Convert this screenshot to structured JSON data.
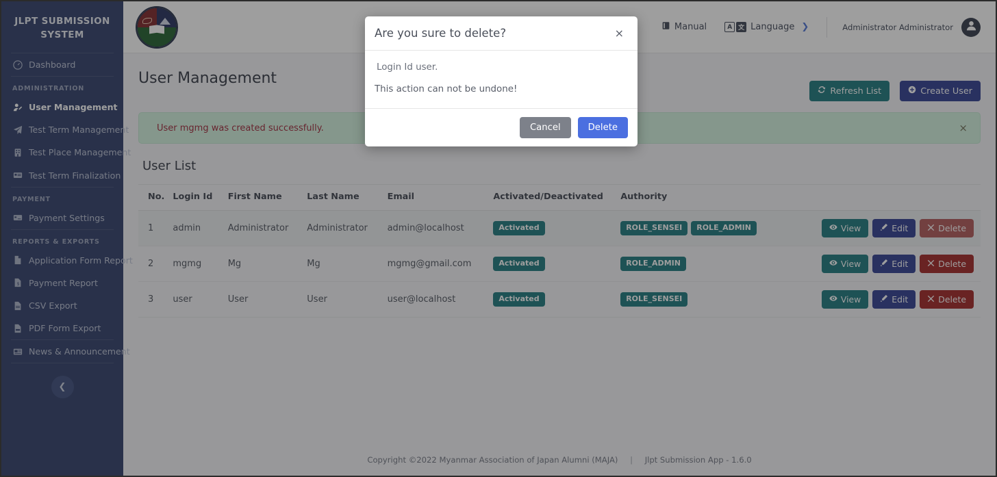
{
  "sidebar": {
    "brand": "JLPT SUBMISSION SYSTEM",
    "items": [
      {
        "label": "Dashboard",
        "icon": "dashboard-icon"
      }
    ],
    "sections": [
      {
        "heading": "ADMINISTRATION",
        "items": [
          {
            "label": "User Management",
            "icon": "user-edit-icon",
            "active": true
          },
          {
            "label": "Test Term Management",
            "icon": "paper-plane-icon",
            "active": false
          },
          {
            "label": "Test Place Management",
            "icon": "building-icon",
            "active": false
          },
          {
            "label": "Test Term Finalization",
            "icon": "id-card-icon",
            "active": false
          }
        ]
      },
      {
        "heading": "PAYMENT",
        "items": [
          {
            "label": "Payment Settings",
            "icon": "credit-card-icon",
            "active": false
          }
        ]
      },
      {
        "heading": "REPORTS & EXPORTS",
        "items": [
          {
            "label": "Application Form Report",
            "icon": "file-icon",
            "active": false
          },
          {
            "label": "Payment Report",
            "icon": "file-invoice-icon",
            "active": false
          },
          {
            "label": "CSV Export",
            "icon": "file-csv-icon",
            "active": false
          },
          {
            "label": "PDF Form Export",
            "icon": "file-pdf-icon",
            "active": false
          }
        ]
      },
      {
        "heading": "",
        "items": [
          {
            "label": "News & Announcement",
            "icon": "newspaper-icon",
            "active": false
          }
        ]
      }
    ],
    "collapse_icon": "chevron-left-icon"
  },
  "topbar": {
    "logo_alt": "maja-logo",
    "manual_label": "Manual",
    "manual_icon": "book-icon",
    "language_label": "Language",
    "language_icon": "translate-icon",
    "language_chevron": "❯",
    "user_name": "Administrator Administrator",
    "avatar_icon": "user-avatar-icon"
  },
  "page": {
    "title": "User Management",
    "refresh_label": "Refresh List",
    "refresh_icon": "sync-icon",
    "create_label": "Create User",
    "create_icon": "plus-circle-icon",
    "alert_text": "User mgmg was created successfully.",
    "alert_close": "×",
    "list_title": "User List"
  },
  "table": {
    "columns": [
      "No.",
      "Login Id",
      "First Name",
      "Last Name",
      "Email",
      "Activated/Deactivated",
      "Authority"
    ],
    "rows": [
      {
        "no": "1",
        "login_id": "admin",
        "first_name": "Administrator",
        "last_name": "Administrator",
        "email": "admin@localhost",
        "status": "Activated",
        "authorities": [
          "ROLE_SENSEI",
          "ROLE_ADMIN"
        ],
        "highlight": true,
        "delete_lit": true
      },
      {
        "no": "2",
        "login_id": "mgmg",
        "first_name": "Mg",
        "last_name": "Mg",
        "email": "mgmg@gmail.com",
        "status": "Activated",
        "authorities": [
          "ROLE_ADMIN"
        ],
        "highlight": false,
        "delete_lit": false
      },
      {
        "no": "3",
        "login_id": "user",
        "first_name": "User",
        "last_name": "User",
        "email": "user@localhost",
        "status": "Activated",
        "authorities": [
          "ROLE_SENSEI"
        ],
        "highlight": false,
        "delete_lit": false
      }
    ],
    "ops": {
      "view_label": "View",
      "view_icon": "eye-icon",
      "edit_label": "Edit",
      "edit_icon": "pencil-icon",
      "delete_label": "Delete",
      "delete_icon": "times-icon"
    }
  },
  "footer": {
    "copyright": "Copyright ©2022 Myanmar Association of Japan Alumni (MAJA)",
    "separator": "|",
    "app_version": "Jlpt Submission App - 1.6.0"
  },
  "modal": {
    "title": "Are you sure to delete?",
    "close_icon": "×",
    "line1": "Login Id user.",
    "line2": "This action can not be undone!",
    "cancel_label": "Cancel",
    "delete_label": "Delete"
  },
  "colors": {
    "sidebar_bg": "#2b3a67",
    "teal": "#17757a",
    "navy": "#2b3a8f",
    "danger": "#9e1f1f",
    "modal_delete_blue": "#4b6fe0",
    "alert_green_bg": "#d2f3de",
    "alert_text": "#9d2235"
  }
}
